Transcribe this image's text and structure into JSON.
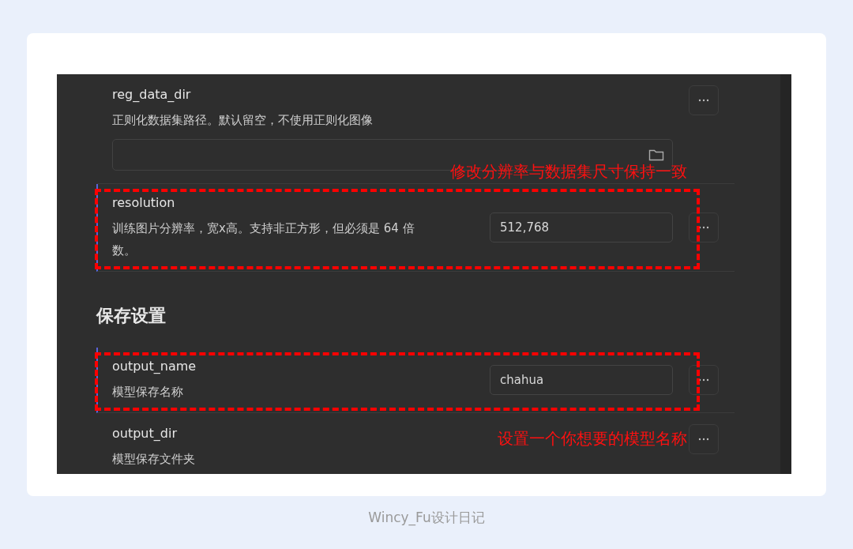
{
  "settings": [
    {
      "kind": "setting",
      "name": "reg_data_dir",
      "description": "正则化数据集路径。默认留空，不使用正则化图像",
      "path_field": true,
      "active": false,
      "highlighted": false,
      "note": "修改分辨率与数据集尺寸保持一致"
    },
    {
      "kind": "setting",
      "name": "resolution",
      "description": "训练图片分辨率，宽x高。支持非正方形，但必须是 64 倍数。",
      "value": "512,768",
      "active": true,
      "highlighted": true
    },
    {
      "kind": "heading",
      "text": "保存设置"
    },
    {
      "kind": "setting",
      "name": "output_name",
      "description": "模型保存名称",
      "value": "chahua",
      "active": true,
      "highlighted": true
    },
    {
      "kind": "setting",
      "name": "output_dir",
      "description": "模型保存文件夹",
      "path_field": false,
      "active": false,
      "highlighted": false,
      "note": "设置一个你想要的模型名称"
    }
  ],
  "caption": "Wincy_Fu设计日记"
}
